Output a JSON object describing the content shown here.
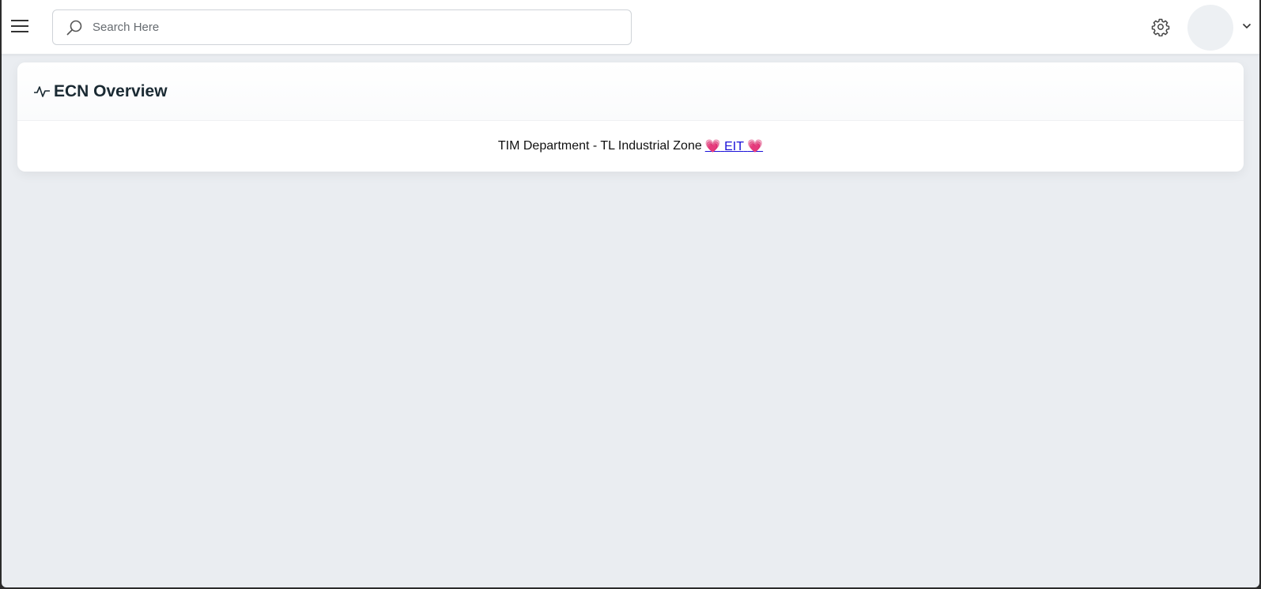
{
  "header": {
    "search": {
      "placeholder": "Search Here",
      "value": ""
    },
    "icons": {
      "menu": "hamburger-icon",
      "search": "search-icon",
      "settings": "gear-icon",
      "user_menu": "chevron-down-icon"
    }
  },
  "card": {
    "title": "ECN Overview",
    "title_icon": "pulse-icon",
    "footer_text": "TIM Department - TL Industrial Zone",
    "link": {
      "heart_left": "💗",
      "label": "EIT",
      "heart_right": "💗"
    }
  },
  "colors": {
    "background": "#eaedf1",
    "link": "#1a10d8",
    "heart": "#e8285a",
    "title": "#1a2a33"
  }
}
